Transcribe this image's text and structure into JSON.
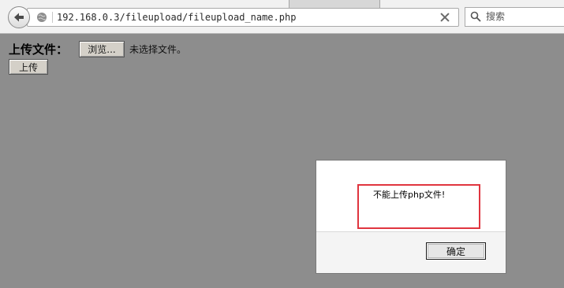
{
  "browser": {
    "url": "192.168.0.3/fileupload/fileupload_name.php",
    "search_placeholder": "搜索"
  },
  "page": {
    "upload_label": "上传文件：",
    "browse_button": "浏览...",
    "no_file_text": "未选择文件。",
    "upload_button": "上传"
  },
  "dialog": {
    "message": "不能上传php文件!",
    "ok_button": "确定"
  },
  "colors": {
    "overlay": "#8d8d8d",
    "highlight": "#e0353f"
  },
  "icons": {
    "back": "back-arrow-icon",
    "site": "globe-icon",
    "clear": "close-icon",
    "search": "search-icon"
  }
}
